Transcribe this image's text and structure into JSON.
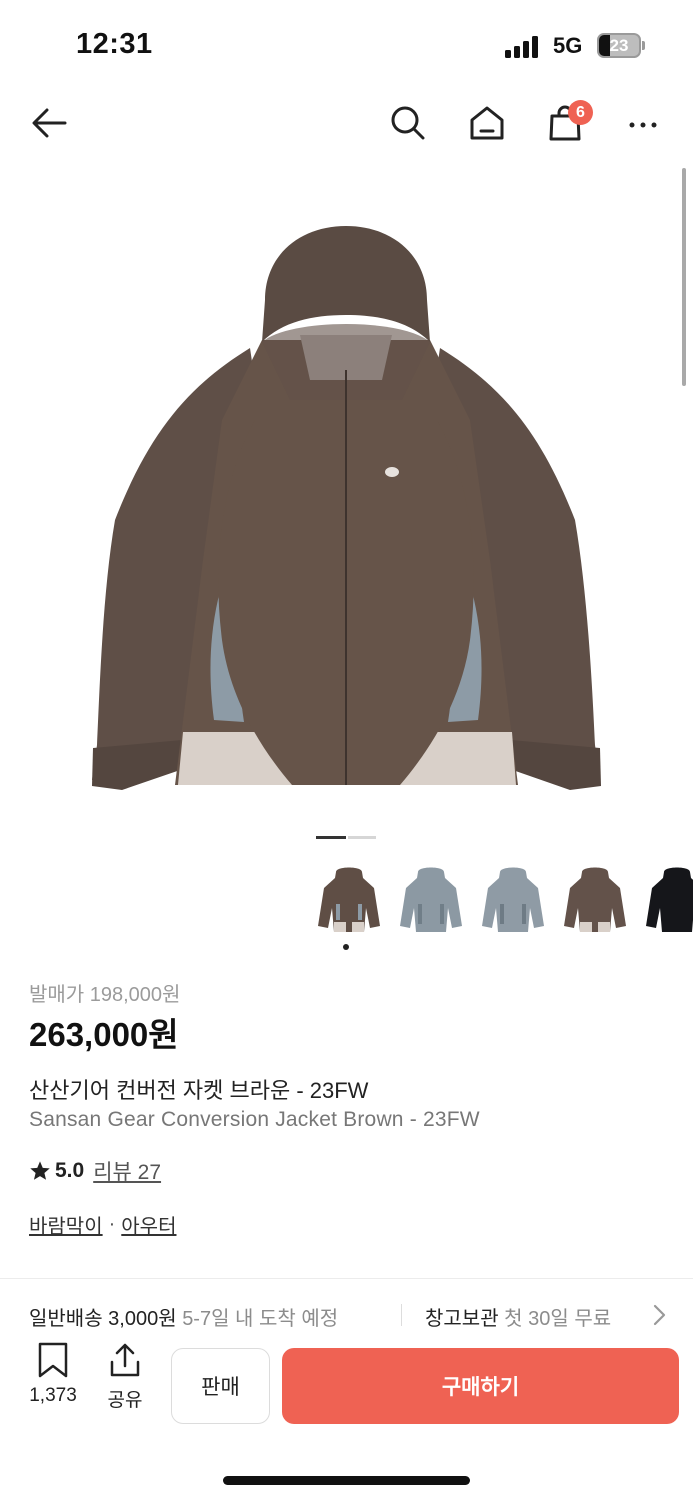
{
  "status_bar": {
    "time": "12:31",
    "network": "5G",
    "battery_level": "23",
    "icons": [
      "signal-icon",
      "battery-icon"
    ]
  },
  "nav": {
    "icons": [
      "back-arrow-icon",
      "search-icon",
      "home-icon",
      "shopping-bag-icon",
      "more-icon"
    ],
    "cart_count": "6"
  },
  "gallery": {
    "current_page": 1,
    "total_pages": 2,
    "product_image": "brown-jacket-image",
    "thumbnails": [
      {
        "color": "brown",
        "hex": "#5f4e45",
        "selected": true
      },
      {
        "color": "grey-blue",
        "hex": "#8c99a3",
        "selected": false
      },
      {
        "color": "grey-blue",
        "hex": "#8f9ba5",
        "selected": false
      },
      {
        "color": "brown",
        "hex": "#63524a",
        "selected": false
      },
      {
        "color": "black",
        "hex": "#15161a",
        "selected": false
      }
    ]
  },
  "product": {
    "release_price": "발매가 198,000원",
    "price": "263,000원",
    "title_ko": "산산기어 컨버전 자켓 브라운 - 23FW",
    "title_en": "Sansan Gear Conversion Jacket Brown - 23FW",
    "rating": "5.0",
    "review_label": "리뷰 27",
    "categories": [
      "바람막이",
      "아우터"
    ],
    "category_separator": "·"
  },
  "shipping": {
    "type": "일반배송",
    "fee": "3,000원",
    "eta": "5-7일 내 도착 예정",
    "storage": "창고보관",
    "storage_promo": "첫 30일 무료"
  },
  "bottom_bar": {
    "bookmark_count": "1,373",
    "share_label": "공유",
    "sell_label": "판매",
    "buy_label": "구매하기"
  },
  "colors": {
    "accent": "#ef6253",
    "text": "#222222",
    "muted": "#8c8c8c"
  }
}
